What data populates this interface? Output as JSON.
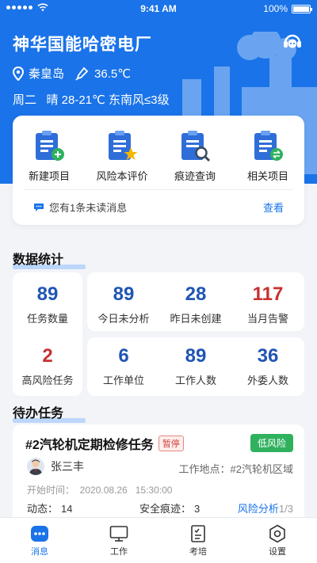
{
  "status_bar": {
    "time": "9:41 AM",
    "battery": "100%"
  },
  "header": {
    "plant_name": "神华国能哈密电厂",
    "location": "秦皇岛",
    "temperature": "36.5℃",
    "weather": "周二   晴 28-21℃ 东南风≤3级"
  },
  "quick_actions": [
    {
      "label": "新建项目",
      "icon": "clipboard-add-icon"
    },
    {
      "label": "风险本评价",
      "icon": "clipboard-star-icon"
    },
    {
      "label": "痕迹查询",
      "icon": "clipboard-search-icon"
    },
    {
      "label": "相关项目",
      "icon": "clipboard-exchange-icon"
    }
  ],
  "message": {
    "text": "您有1条未读消息",
    "action": "查看"
  },
  "stats": {
    "title": "数据统计",
    "items": [
      {
        "num": "89",
        "label": "任务数量"
      },
      {
        "num": "89",
        "label": "今日未分析"
      },
      {
        "num": "28",
        "label": "昨日未创建"
      },
      {
        "num": "117",
        "label": "当月告警"
      },
      {
        "num": "2",
        "label": "高风险任务"
      },
      {
        "num": "6",
        "label": "工作单位"
      },
      {
        "num": "89",
        "label": "工作人数"
      },
      {
        "num": "36",
        "label": "外委人数"
      }
    ]
  },
  "todo": {
    "title": "待办任务",
    "task": {
      "title": "#2汽轮机定期检修任务",
      "status": "暂停",
      "risk": "低风险",
      "person": "张三丰",
      "location": "工作地点：#2汽轮机区域",
      "start": "开始时间：  2020.08.26   15:30:00",
      "dynamic_label": "动态：",
      "dynamic_value": "14",
      "trace_label": "安全痕迹：",
      "trace_value": "3",
      "analysis_label": "风险分析",
      "analysis_value": "1/3"
    }
  },
  "tabs": [
    {
      "label": "消息",
      "icon": "message-icon",
      "active": true
    },
    {
      "label": "工作",
      "icon": "monitor-icon",
      "active": false
    },
    {
      "label": "考培",
      "icon": "checklist-icon",
      "active": false
    },
    {
      "label": "设置",
      "icon": "settings-icon",
      "active": false
    }
  ],
  "colors": {
    "primary": "#1a73e8",
    "stat_blue": "#1f55b4",
    "alert_red": "#c8312f",
    "risk_green": "#2fb15e"
  }
}
